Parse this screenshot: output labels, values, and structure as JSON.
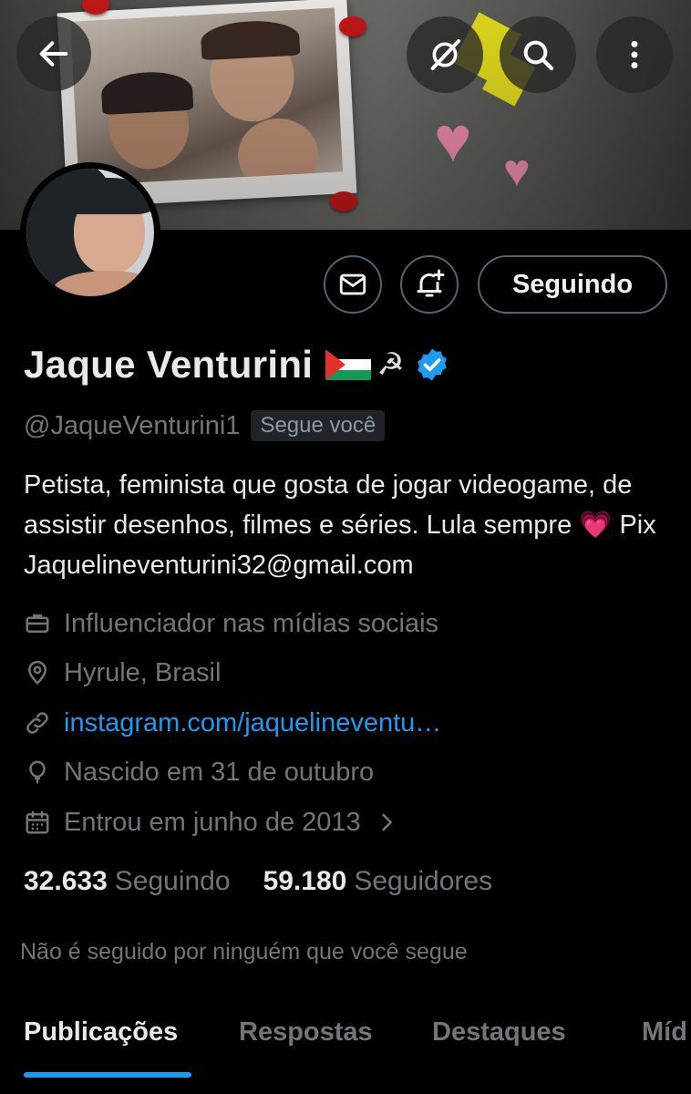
{
  "header": {
    "back_icon": "arrow-left-icon",
    "grok_icon": "grok-icon",
    "search_icon": "search-icon",
    "more_icon": "more-vertical-icon"
  },
  "actions": {
    "message_icon": "mail-icon",
    "notify_icon": "bell-plus-icon",
    "follow_label": "Seguindo"
  },
  "profile": {
    "name": "Jaque Venturini",
    "name_emojis": "☭",
    "verified": true,
    "handle": "@JaqueVenturini1",
    "follows_you_badge": "Segue você",
    "bio_part1": "Petista, feminista que gosta de jogar videogame, de assistir desenhos, filmes e séries. Lula sempre",
    "bio_emoji": "💗",
    "bio_part2": "Pix Jaquelineventurini32@gmail.com",
    "category": "Influenciador nas mídias sociais",
    "location": "Hyrule, Brasil",
    "website": "instagram.com/jaquelineventu…",
    "birthday": "Nascido em 31 de outubro",
    "joined": "Entrou em junho de 2013"
  },
  "stats": {
    "following_count": "32.633",
    "following_label": "Seguindo",
    "followers_count": "59.180",
    "followers_label": "Seguidores"
  },
  "social_context": "Não é seguido por ninguém que você segue",
  "tabs": [
    {
      "label": "Publicações",
      "active": true
    },
    {
      "label": "Respostas",
      "active": false
    },
    {
      "label": "Destaques",
      "active": false
    },
    {
      "label": "Míd",
      "active": false
    }
  ],
  "colors": {
    "accent": "#1d9bf0",
    "text": "#e7e9ea",
    "muted": "#71767b",
    "background": "#000000"
  }
}
